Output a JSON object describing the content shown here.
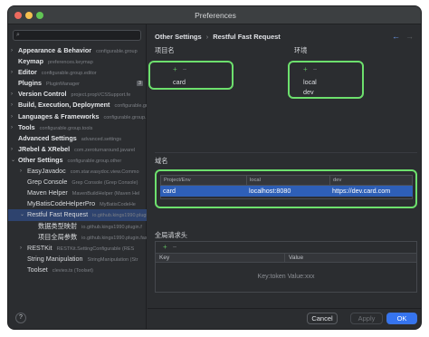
{
  "window": {
    "title": "Preferences"
  },
  "search": {
    "placeholder": ""
  },
  "sidebar": {
    "items": [
      {
        "label": "Appearance & Behavior",
        "sub": "configurable.group",
        "arrow": "right",
        "indent": 0,
        "bold": true
      },
      {
        "label": "Keymap",
        "sub": "preferences.keymap",
        "arrow": "",
        "indent": 0,
        "bold": true
      },
      {
        "label": "Editor",
        "sub": "configurable.group.editor",
        "arrow": "right",
        "indent": 0,
        "bold": true
      },
      {
        "label": "Plugins",
        "sub": "PluginManager",
        "arrow": "",
        "indent": 0,
        "bold": true,
        "badge": "3"
      },
      {
        "label": "Version Control",
        "sub": "project.propVCSSupport.fe",
        "arrow": "right",
        "indent": 0,
        "bold": true
      },
      {
        "label": "Build, Execution, Deployment",
        "sub": "configurable.group",
        "arrow": "right",
        "indent": 0,
        "bold": true
      },
      {
        "label": "Languages & Frameworks",
        "sub": "configurable.group.la",
        "arrow": "right",
        "indent": 0,
        "bold": true
      },
      {
        "label": "Tools",
        "sub": "configurable.group.tools",
        "arrow": "right",
        "indent": 0,
        "bold": true
      },
      {
        "label": "Advanced Settings",
        "sub": "advanced.settings",
        "arrow": "",
        "indent": 0,
        "bold": true
      },
      {
        "label": "JRebel & XRebel",
        "sub": "com.zeroturnaround.javarel",
        "arrow": "right",
        "indent": 0,
        "bold": true
      },
      {
        "label": "Other Settings",
        "sub": "configurable.group.other",
        "arrow": "down",
        "indent": 0,
        "bold": true
      },
      {
        "label": "EasyJavadoc",
        "sub": "com.star.easydoc.view.Commo",
        "arrow": "right",
        "indent": 1,
        "bold": false
      },
      {
        "label": "Grep Console",
        "sub": "Grep Console (Grep Console)",
        "arrow": "",
        "indent": 1,
        "bold": false
      },
      {
        "label": "Maven Helper",
        "sub": "MavenBuildHelper (Maven Hel",
        "arrow": "",
        "indent": 1,
        "bold": false
      },
      {
        "label": "MyBatisCodeHelperPro",
        "sub": "MyBatisCodeHe",
        "arrow": "",
        "indent": 1,
        "bold": false
      },
      {
        "label": "Restful Fast Request",
        "sub": "io.github.kings1990.plugin",
        "arrow": "down",
        "indent": 1,
        "bold": false,
        "selected": true
      },
      {
        "label": "数据类型映射",
        "sub": "io.github.kings1990.plugin.f",
        "arrow": "",
        "indent": 2,
        "bold": false
      },
      {
        "label": "项目全局参数",
        "sub": "io.github.kings1990.plugin.fastre",
        "arrow": "",
        "indent": 2,
        "bold": false
      },
      {
        "label": "RESTKit",
        "sub": "RESTKit.SettingConfigurable (RES",
        "arrow": "right",
        "indent": 1,
        "bold": false
      },
      {
        "label": "String Manipulation",
        "sub": "StringManipulation (Str",
        "arrow": "",
        "indent": 1,
        "bold": false
      },
      {
        "label": "Toolset",
        "sub": "clevies.ts (Toolset)",
        "arrow": "",
        "indent": 1,
        "bold": false
      }
    ]
  },
  "breadcrumb": {
    "parent": "Other Settings",
    "separator": "›",
    "current": "Restful Fast Request"
  },
  "nav": {
    "back": "←",
    "forward": "→"
  },
  "projects": {
    "label": "项目名",
    "add": "+",
    "remove": "−",
    "items": [
      "card"
    ]
  },
  "envs": {
    "label": "环境",
    "add": "+",
    "remove": "−",
    "items": [
      "local",
      "dev"
    ]
  },
  "domain": {
    "label": "域名",
    "columns": [
      "Project/Env",
      "local",
      "dev"
    ],
    "rows": [
      [
        "card",
        "localhost:8080",
        "https://dev.card.com"
      ]
    ]
  },
  "global_headers": {
    "label": "全局请求头",
    "add": "+",
    "remove": "−",
    "columns": [
      "Key",
      "Value"
    ],
    "empty_text": "Key:token  Value:xxx"
  },
  "footer": {
    "cancel": "Cancel",
    "apply": "Apply",
    "ok": "OK"
  },
  "colors": {
    "highlight": "#6de06d",
    "selection": "#2e5fb7",
    "ok": "#3574f0"
  }
}
